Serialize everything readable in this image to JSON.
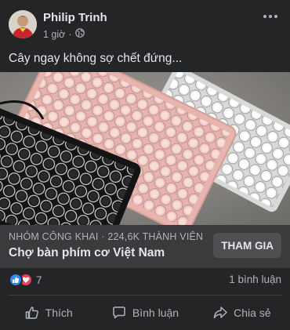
{
  "post": {
    "author": "Philip Trinh",
    "time": "1 giờ",
    "separator": "·",
    "audience_icon": "globe-icon",
    "more_icon": "more-options-icon",
    "caption": "Cây ngay không sợ chết đứng..."
  },
  "image": {
    "subject": "mechanical-keyboards-photo"
  },
  "group": {
    "label": "NHÓM CÔNG KHAI · 224,6K THÀNH VIÊN",
    "name": "Chợ bàn phím cơ Việt Nam",
    "join_label": "THAM GIA"
  },
  "stats": {
    "reaction_count": "7",
    "comment_count": "1 bình luận",
    "reaction_icons": [
      "like-reaction-icon",
      "love-reaction-icon"
    ]
  },
  "actions": [
    {
      "label": "Thích",
      "icon": "thumbs-up-icon"
    },
    {
      "label": "Bình luận",
      "icon": "comment-icon"
    },
    {
      "label": "Chia sẻ",
      "icon": "share-icon"
    }
  ],
  "colors": {
    "card_bg": "#242526",
    "group_bar_bg": "#3a3b3c",
    "like_blue": "#2d88ff",
    "love_red": "#f33e58",
    "text_primary": "#e4e6eb",
    "text_secondary": "#b0b3b8"
  }
}
